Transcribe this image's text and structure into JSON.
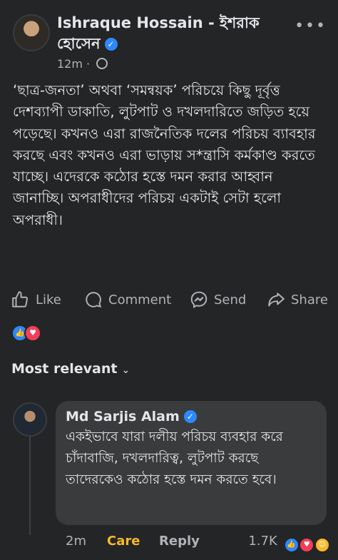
{
  "post": {
    "author_line1": "Ishraque Hossain - ইশরাক",
    "author_line2": "হোসেন",
    "time": "12m",
    "more": "•••",
    "body": "‘ছাত্র-জনতা’ অথবা ‘সমন্বয়ক’ পরিচয়ে কিছু দূর্বৃত্ত দেশব্যাপী ডাকাতি, লুটপাট ও দখলদারিতে জড়িত হয়ে পড়েছে। কখনও এরা রাজনৈতিক দলের পরিচয় ব্যাবহার করছে এবং কখনও এরা ভাড়ায় স*ন্ত্রাসি কর্মকাণ্ড করতে যাচ্ছে। এদেরকে কঠোর হস্তে দমন করার আহ্বান জানাচ্ছি। অপরাধীদের পরিচয় একটাই সেটা হলো অপরাধী।"
  },
  "actions": {
    "like": "Like",
    "comment": "Comment",
    "send": "Send",
    "share": "Share"
  },
  "reactions": [
    "like-icon",
    "love-icon"
  ],
  "sort_label": "Most relevant",
  "comment": {
    "author": "Md Sarjis Alam",
    "text": "একইভাবে যারা দলীয় পরিচয় ব্যবহার করে চাঁদাবাজি, দখলদারিত্ব, লুটপাট করছে তাদেরকেও কঠোর হস্তে দমন করতে হবে।",
    "time": "2m",
    "reaction_label": "Care",
    "reply": "Reply",
    "count": "1.7K",
    "reaction_icons": [
      "like-icon",
      "love-icon",
      "care-icon"
    ]
  },
  "colors": {
    "background": "#242526",
    "bubble": "#3a3b3c",
    "verified": "#2d88ff",
    "care": "#f7b928",
    "love": "#f33e58"
  }
}
